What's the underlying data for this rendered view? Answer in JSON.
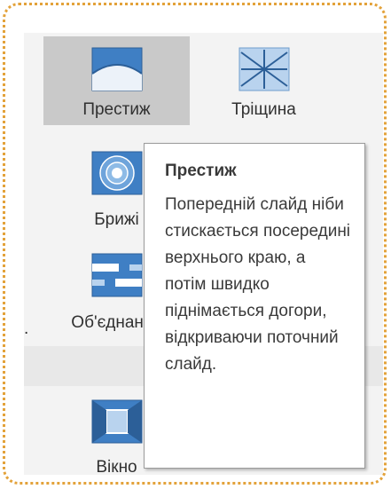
{
  "gallery": {
    "tiles": [
      {
        "label": "Престиж",
        "icon": "prestige-transition-icon",
        "selected": true
      },
      {
        "label": "Тріщина",
        "icon": "shatter-transition-icon"
      },
      {
        "label": "Брижі",
        "icon": "ripple-transition-icon"
      },
      {
        "label": "Об'єднання",
        "icon": "merge-transition-icon"
      },
      {
        "label": "Вікно",
        "icon": "window-transition-icon"
      }
    ],
    "partial_left": "."
  },
  "tooltip": {
    "title": "Престиж",
    "description": "Попередній слайд ніби стискається посередині верхнього краю, а потім швидко піднімається догори, відкриваючи поточний слайд."
  },
  "colors": {
    "icon_blue": "#3f7fc4",
    "icon_light": "#b9d3ee",
    "selected_bg": "#c9c9c9",
    "border_dots": "#e3a23a"
  }
}
